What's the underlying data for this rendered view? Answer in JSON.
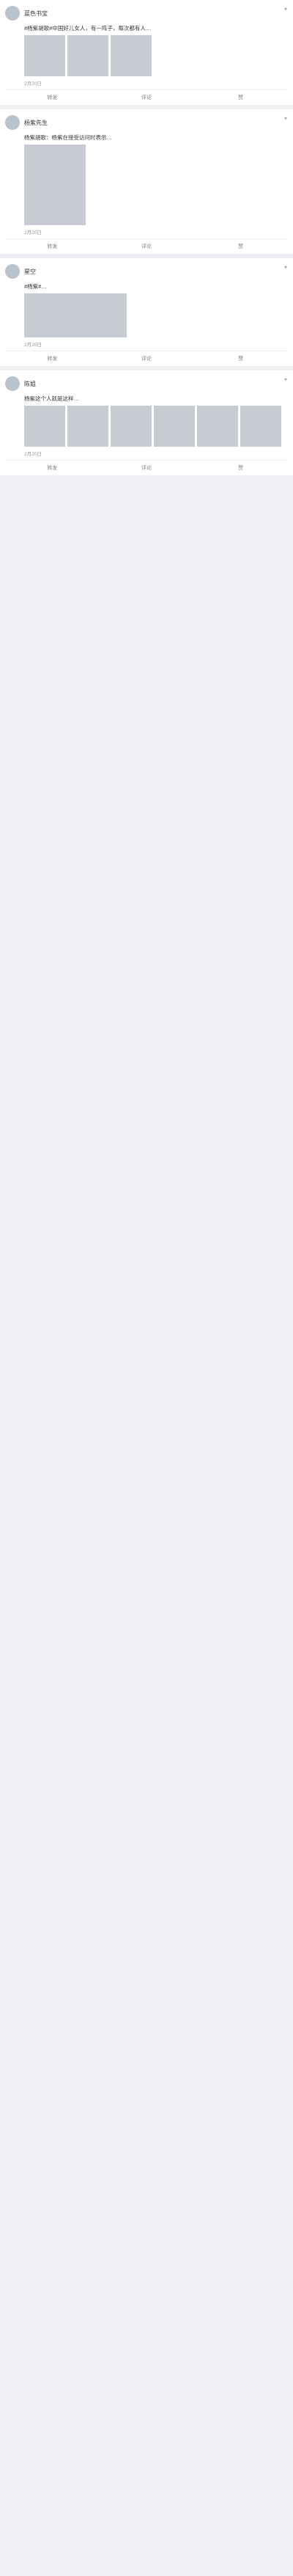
{
  "menu_glyph": "▾",
  "actions": {
    "forward": "转发",
    "comment": "评论",
    "like": "赞"
  },
  "posts": [
    {
      "user": "蓝色书宝",
      "text": "#杨紫胡歌#中国好儿女人，有一阵子，每次都有人…",
      "meta": "2月20日"
    },
    {
      "user": "杨紫先生",
      "text": "杨紫胡歌：杨紫在接受访问时表示…",
      "meta": "2月20日"
    },
    {
      "user": "星空",
      "text": "#杨紫#…",
      "meta": "2月20日"
    },
    {
      "user": "陈姐",
      "text": "杨紫这个人就是这样…",
      "meta": "2月20日"
    }
  ]
}
